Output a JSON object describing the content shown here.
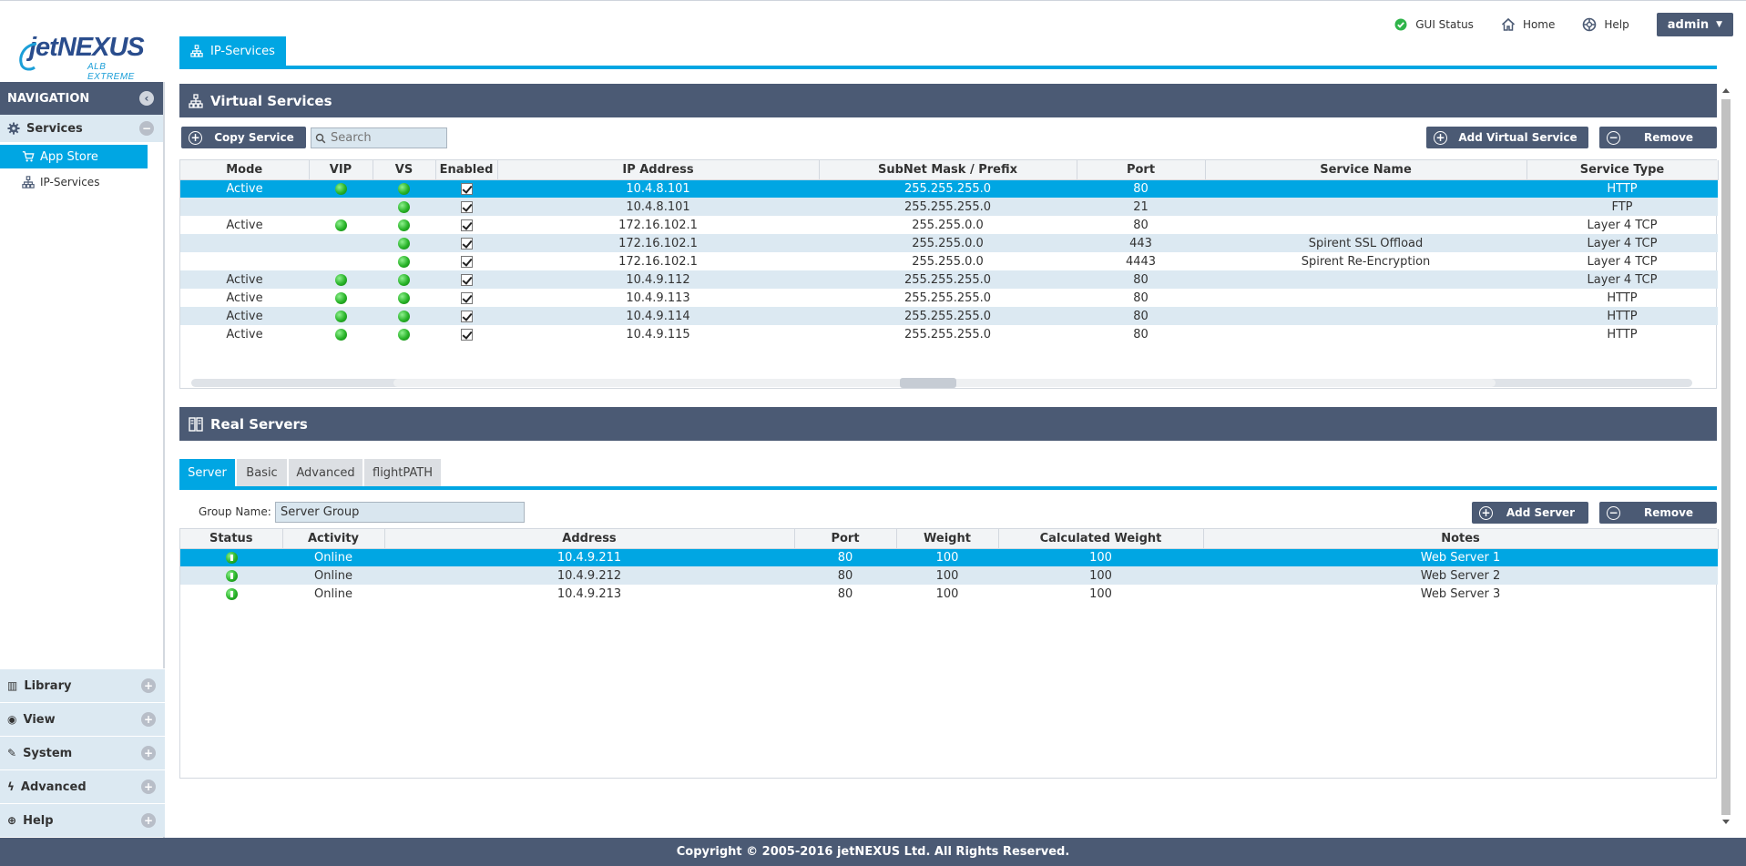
{
  "header": {
    "links": [
      {
        "label": "GUI Status",
        "icon": "check-circle-icon"
      },
      {
        "label": "Home",
        "icon": "home-icon"
      },
      {
        "label": "Help",
        "icon": "lifebuoy-icon"
      }
    ],
    "user": "admin"
  },
  "logo": {
    "brand": "jetNEXUS",
    "subtitle": "ALB EXTREME"
  },
  "sidebar": {
    "title": "NAVIGATION",
    "services": {
      "label": "Services",
      "items": [
        "App Store",
        "IP-Services"
      ]
    },
    "bottom_sections": [
      "Library",
      "View",
      "System",
      "Advanced",
      "Help"
    ]
  },
  "page_tab": "IP-Services",
  "virtual_services": {
    "title": "Virtual Services",
    "copy_label": "Copy Service",
    "search_placeholder": "Search",
    "add_label": "Add Virtual Service",
    "remove_label": "Remove",
    "columns": [
      "Mode",
      "VIP",
      "VS",
      "Enabled",
      "IP Address",
      "SubNet Mask / Prefix",
      "Port",
      "Service Name",
      "Service Type"
    ],
    "rows": [
      {
        "mode": "Active",
        "vip": true,
        "vs": true,
        "enabled": true,
        "ip": "10.4.8.101",
        "mask": "255.255.255.0",
        "port": "80",
        "name": "",
        "type": "HTTP",
        "selected": true
      },
      {
        "mode": "",
        "vip": false,
        "vs": true,
        "enabled": true,
        "ip": "10.4.8.101",
        "mask": "255.255.255.0",
        "port": "21",
        "name": "",
        "type": "FTP"
      },
      {
        "mode": "Active",
        "vip": true,
        "vs": true,
        "enabled": true,
        "ip": "172.16.102.1",
        "mask": "255.255.0.0",
        "port": "80",
        "name": "",
        "type": "Layer 4 TCP"
      },
      {
        "mode": "",
        "vip": false,
        "vs": true,
        "enabled": true,
        "ip": "172.16.102.1",
        "mask": "255.255.0.0",
        "port": "443",
        "name": "Spirent SSL Offload",
        "type": "Layer 4 TCP"
      },
      {
        "mode": "",
        "vip": false,
        "vs": true,
        "enabled": true,
        "ip": "172.16.102.1",
        "mask": "255.255.0.0",
        "port": "4443",
        "name": "Spirent Re-Encryption",
        "type": "Layer 4 TCP"
      },
      {
        "mode": "Active",
        "vip": true,
        "vs": true,
        "enabled": true,
        "ip": "10.4.9.112",
        "mask": "255.255.255.0",
        "port": "80",
        "name": "",
        "type": "Layer 4 TCP"
      },
      {
        "mode": "Active",
        "vip": true,
        "vs": true,
        "enabled": true,
        "ip": "10.4.9.113",
        "mask": "255.255.255.0",
        "port": "80",
        "name": "",
        "type": "HTTP"
      },
      {
        "mode": "Active",
        "vip": true,
        "vs": true,
        "enabled": true,
        "ip": "10.4.9.114",
        "mask": "255.255.255.0",
        "port": "80",
        "name": "",
        "type": "HTTP"
      },
      {
        "mode": "Active",
        "vip": true,
        "vs": true,
        "enabled": true,
        "ip": "10.4.9.115",
        "mask": "255.255.255.0",
        "port": "80",
        "name": "",
        "type": "HTTP"
      }
    ]
  },
  "real_servers": {
    "title": "Real Servers",
    "tabs": [
      "Server",
      "Basic",
      "Advanced",
      "flightPATH"
    ],
    "active_tab": "Server",
    "group_label": "Group Name:",
    "group_value": "Server Group",
    "add_label": "Add Server",
    "remove_label": "Remove",
    "columns": [
      "Status",
      "Activity",
      "Address",
      "Port",
      "Weight",
      "Calculated Weight",
      "Notes"
    ],
    "rows": [
      {
        "activity": "Online",
        "address": "10.4.9.211",
        "port": "80",
        "weight": "100",
        "calc": "100",
        "notes": "Web Server 1",
        "selected": true
      },
      {
        "activity": "Online",
        "address": "10.4.9.212",
        "port": "80",
        "weight": "100",
        "calc": "100",
        "notes": "Web Server 2"
      },
      {
        "activity": "Online",
        "address": "10.4.9.213",
        "port": "80",
        "weight": "100",
        "calc": "100",
        "notes": "Web Server 3"
      }
    ]
  },
  "footer": "Copyright © 2005-2016 jetNEXUS Ltd. All Rights Reserved.",
  "colors": {
    "accent": "#00a6e3",
    "header": "#4b5a74",
    "row_alt": "#dce9f2",
    "status_green": "#27b327"
  }
}
